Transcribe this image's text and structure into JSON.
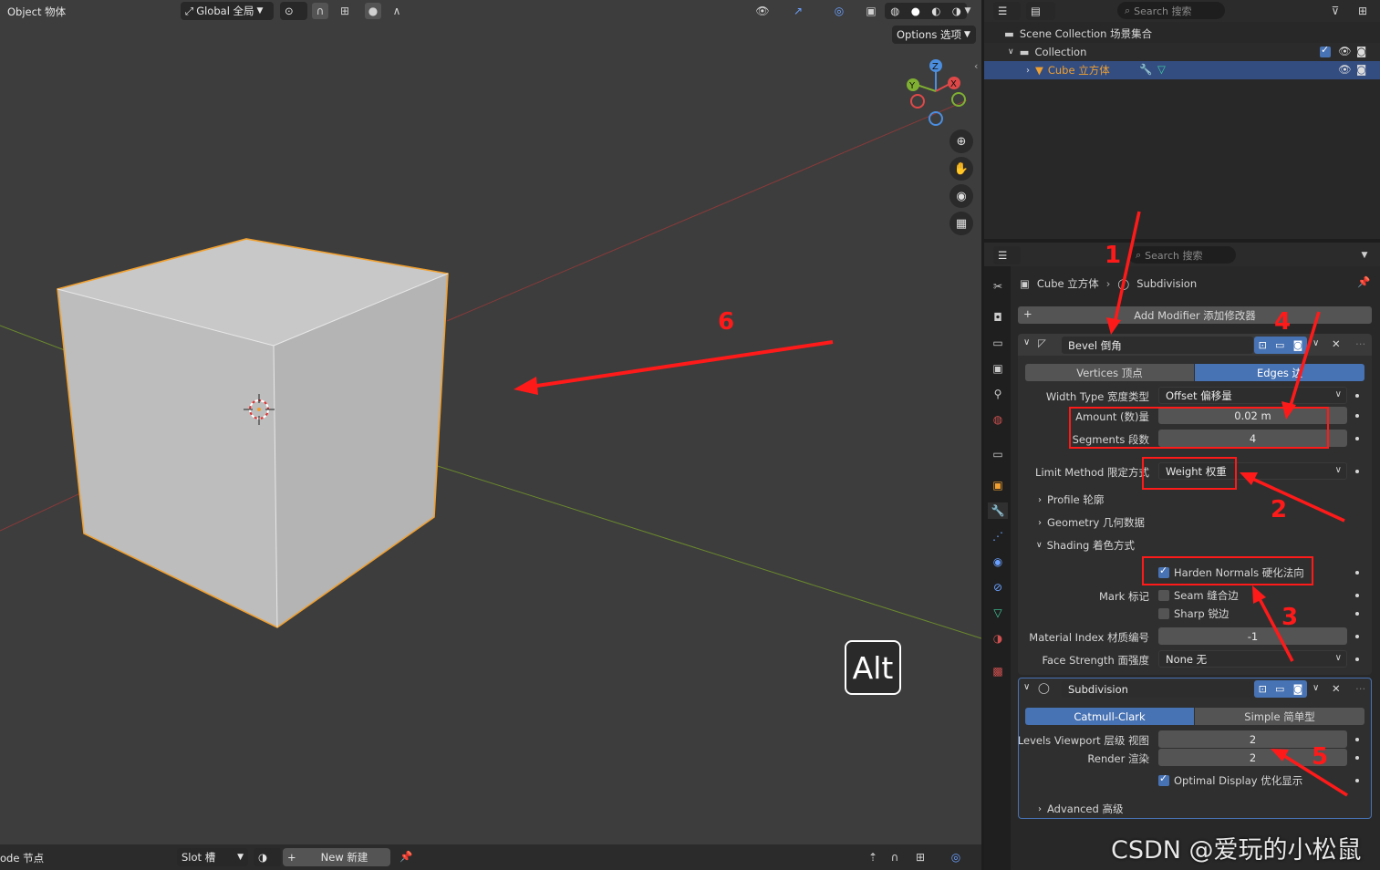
{
  "viewport": {
    "mode_label": "Object 物体",
    "transform_label": "Global 全局",
    "options_label": "Options 选项",
    "key_overlay": "Alt"
  },
  "gizmo": {
    "z": "Z",
    "y": "Y",
    "x": "X"
  },
  "footer": {
    "node_label": "ode 节点",
    "slot_label": "Slot 槽",
    "new_label": "New 新建"
  },
  "outliner": {
    "search_placeholder": "Search 搜索",
    "scene_collection": "Scene Collection 场景集合",
    "collection": "Collection",
    "cube": "Cube 立方体"
  },
  "properties": {
    "search_placeholder": "Search 搜索",
    "breadcrumb_object": "Cube 立方体",
    "breadcrumb_modifier": "Subdivision",
    "add_modifier": "Add Modifier 添加修改器",
    "bevel": {
      "name": "Bevel 倒角",
      "tab_vertices": "Vertices 顶点",
      "tab_edges": "Edges 边",
      "width_type_label": "Width Type 宽度类型",
      "width_type_value": "Offset 偏移量",
      "amount_label": "Amount (数)量",
      "amount_value": "0.02 m",
      "segments_label": "Segments 段数",
      "segments_value": "4",
      "limit_method_label": "Limit Method 限定方式",
      "limit_method_value": "Weight 权重",
      "profile": "Profile 轮廓",
      "geometry": "Geometry 几何数据",
      "shading": "Shading 着色方式",
      "harden_normals": "Harden Normals 硬化法向",
      "mark_label": "Mark 标记",
      "seam": "Seam 缝合边",
      "sharp": "Sharp 锐边",
      "material_index_label": "Material Index 材质编号",
      "material_index_value": "-1",
      "face_strength_label": "Face Strength 面强度",
      "face_strength_value": "None 无"
    },
    "subdivision": {
      "name": "Subdivision",
      "tab_catmull": "Catmull-Clark",
      "tab_simple": "Simple 简单型",
      "levels_viewport_label": "Levels Viewport 层级 视图",
      "levels_viewport_value": "2",
      "render_label": "Render 渲染",
      "render_value": "2",
      "optimal_display": "Optimal Display 优化显示",
      "advanced": "Advanced 高级"
    }
  },
  "annotations": [
    "1",
    "2",
    "3",
    "4",
    "5",
    "6"
  ],
  "watermark": "CSDN @爱玩的小松鼠"
}
